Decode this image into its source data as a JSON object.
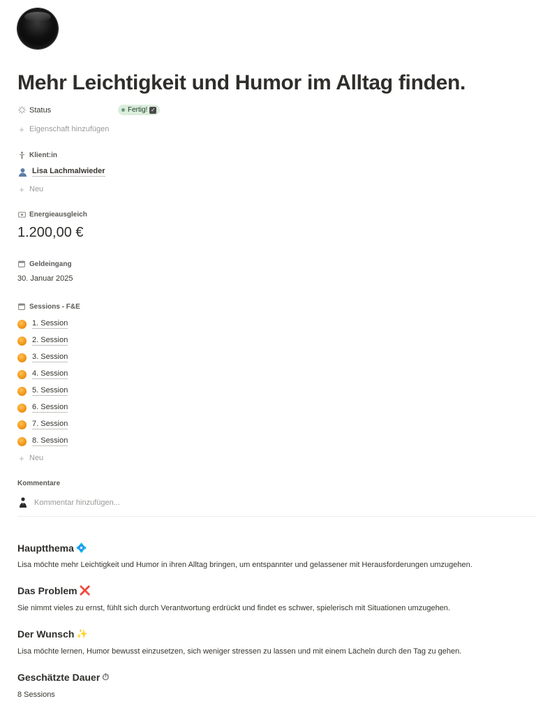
{
  "page": {
    "title": "Mehr Leichtigkeit und Humor im Alltag finden."
  },
  "properties": {
    "status_label": "Status",
    "status_value": "Fertig!",
    "add_property": "Eigenschaft hinzufügen",
    "client_label": "Klient:in",
    "client_value": "Lisa Lachmalwieder",
    "client_new": "Neu",
    "energy_label": "Energieausgleich",
    "energy_value": "1.200,00 €",
    "payment_label": "Geldeingang",
    "payment_value": "30. Januar 2025",
    "sessions_label": "Sessions - F&E",
    "sessions": [
      "1. Session",
      "2. Session",
      "3. Session",
      "4. Session",
      "5. Session",
      "6. Session",
      "7. Session",
      "8. Session"
    ],
    "sessions_new": "Neu"
  },
  "comments": {
    "label": "Kommentare",
    "placeholder": "Kommentar hinzufügen..."
  },
  "content": {
    "topic_heading": "Hauptthema",
    "topic_emoji": "💠",
    "topic_text": "Lisa möchte mehr Leichtigkeit und Humor in ihren Alltag bringen, um entspannter und gelassener mit Herausforderungen umzugehen.",
    "problem_heading": "Das Problem",
    "problem_emoji": "❌",
    "problem_text": "Sie nimmt vieles zu ernst, fühlt sich durch Verantwortung erdrückt und findet es schwer, spielerisch mit Situationen umzugehen.",
    "wish_heading": "Der Wunsch",
    "wish_emoji": "✨",
    "wish_text": "Lisa möchte lernen, Humor bewusst einzusetzen, sich weniger stressen zu lassen und mit einem Lächeln durch den Tag zu gehen.",
    "duration_heading": "Geschätzte Dauer",
    "duration_emoji": "⏱",
    "duration_text": "8 Sessions"
  },
  "colors": {
    "status_badge_bg": "#dbeddb",
    "status_dot": "#6c9b7d",
    "session_icon": "#f39c1e"
  },
  "icons": {
    "page_icon": "black-sphere-icon",
    "status": "loading-spinner-icon",
    "client": "person-icon",
    "client_item": "bust-icon",
    "energy": "banknote-icon",
    "payment": "calendar-icon",
    "sessions": "calendar-icon",
    "session_item": "orange-circle-icon",
    "add": "plus-icon",
    "comment_avatar": "user-avatar"
  }
}
